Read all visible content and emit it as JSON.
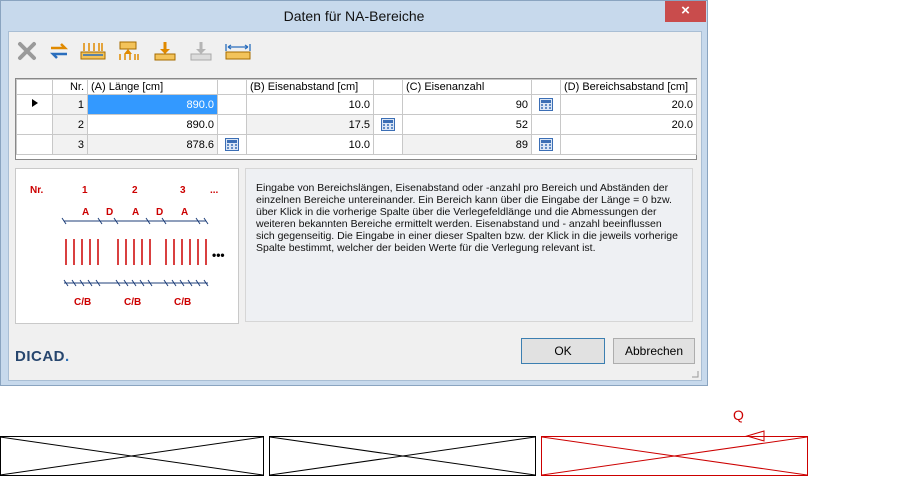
{
  "window": {
    "title": "Daten für NA-Bereiche",
    "close_glyph": "×"
  },
  "toolbar": {
    "buttons": [
      {
        "name": "delete-icon"
      },
      {
        "name": "swap-columns-icon"
      },
      {
        "name": "insert-row-above-icon"
      },
      {
        "name": "insert-row-below-icon"
      },
      {
        "name": "move-down-icon"
      },
      {
        "name": "disabled-move-icon"
      },
      {
        "name": "measure-length-icon"
      }
    ]
  },
  "table": {
    "headers": {
      "nr": "Nr.",
      "a": "(A) Länge [cm]",
      "b": "(B) Eisenabstand [cm]",
      "c": "(C) Eisenanzahl",
      "d": "(D) Bereichsabstand [cm]"
    },
    "rows": [
      {
        "nr": "1",
        "a": "890.0",
        "b": "10.0",
        "c": "90",
        "d": "20.0"
      },
      {
        "nr": "2",
        "a": "890.0",
        "b": "17.5",
        "c": "52",
        "d": "20.0"
      },
      {
        "nr": "3",
        "a": "878.6",
        "b": "10.0",
        "c": "89",
        "d": ""
      }
    ]
  },
  "legend": {
    "nr": "Nr.",
    "n1": "1",
    "n2": "2",
    "n3": "3",
    "dots": "...",
    "a": "A",
    "d": "D",
    "cb": "C/B",
    "more": "•••"
  },
  "help_text": "Eingabe von Bereichslängen, Eisenabstand oder -anzahl pro Bereich und Abständen der einzelnen Bereiche untereinander. Ein Bereich kann über die Eingabe der Länge = 0 bzw. über Klick in die vorherige Spalte über die Verlegefeldlänge und die Abmessungen der weiteren bekannten Bereiche ermittelt werden. Eisenabstand und - anzahl beeinflussen sich gegenseitig. Die Eingabe in einer dieser Spalten bzw. der Klick in die jeweils vorherige Spalte bestimmt, welcher der beiden Werte für die Verlegung relevant ist.",
  "buttons": {
    "ok": "OK",
    "cancel": "Abbrechen"
  },
  "logo": {
    "text": "DICAD",
    "dot": "."
  },
  "below": {
    "marker_label": "Q"
  },
  "colors": {
    "accent": "#3399ff",
    "legend_red": "#cc0000",
    "title_bg": "#c7d9ec"
  }
}
